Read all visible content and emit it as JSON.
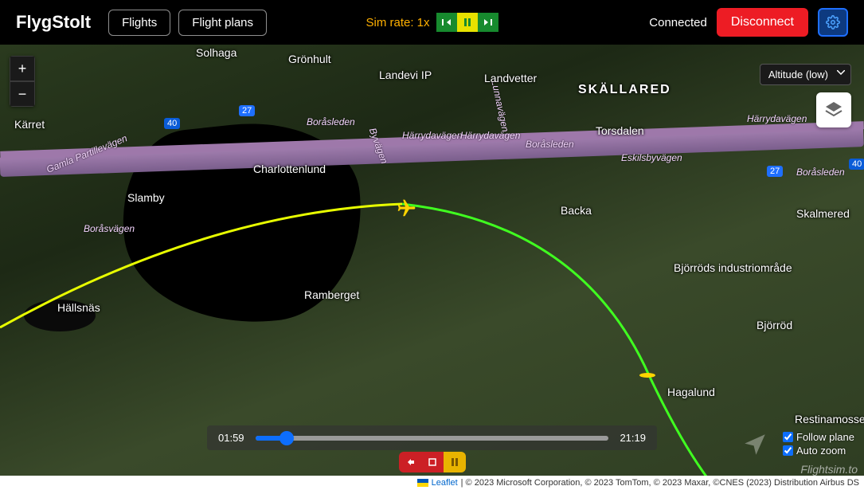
{
  "brand": "FlygStolt",
  "nav": {
    "flights": "Flights",
    "flight_plans": "Flight plans"
  },
  "simrate": {
    "label": "Sim rate: 1x"
  },
  "status": {
    "connected": "Connected",
    "disconnect": "Disconnect"
  },
  "altitude_dropdown": {
    "selected": "Altitude (low)"
  },
  "playback": {
    "start": "01:59",
    "end": "21:19",
    "progress_percent": 9
  },
  "toggles": {
    "follow_plane": "Follow plane",
    "auto_zoom": "Auto zoom",
    "follow_plane_checked": true,
    "auto_zoom_checked": true
  },
  "watermark": "Flightsim.to",
  "attribution": {
    "leaflet": "Leaflet",
    "rest": " | © 2023 Microsoft Corporation, © 2023 TomTom, © 2023 Maxar, ©CNES (2023) Distribution Airbus DS"
  },
  "roads": {
    "r27": "27",
    "r40": "40",
    "borasleden": "Boråsleden",
    "harrydavagen": "Härrydavägen",
    "eskilsbyvagen": "Eskilsbyvägen",
    "borasvagen": "Boråsvägen",
    "gamla": "Gamla Partillevägen",
    "byvagen": "Byvägen",
    "lunnavagen": "Lunnavägen"
  },
  "places": {
    "solhaga": "Solhaga",
    "gronhult": "Grönhult",
    "landevi": "Landevi IP",
    "landvetter": "Landvetter",
    "skallared": "SKÄLLARED",
    "karret": "Kärret",
    "torsdalen": "Torsdalen",
    "charlottenlund": "Charlottenlund",
    "slamby": "Slamby",
    "backa": "Backa",
    "skalmered": "Skalmered",
    "hallsnas": "Hällsnäs",
    "ramberget": "Ramberget",
    "bjorrods": "Björröds industriområde",
    "bjorrod": "Björröd",
    "hagalund": "Hagalund",
    "restina": "Restinamossen"
  }
}
